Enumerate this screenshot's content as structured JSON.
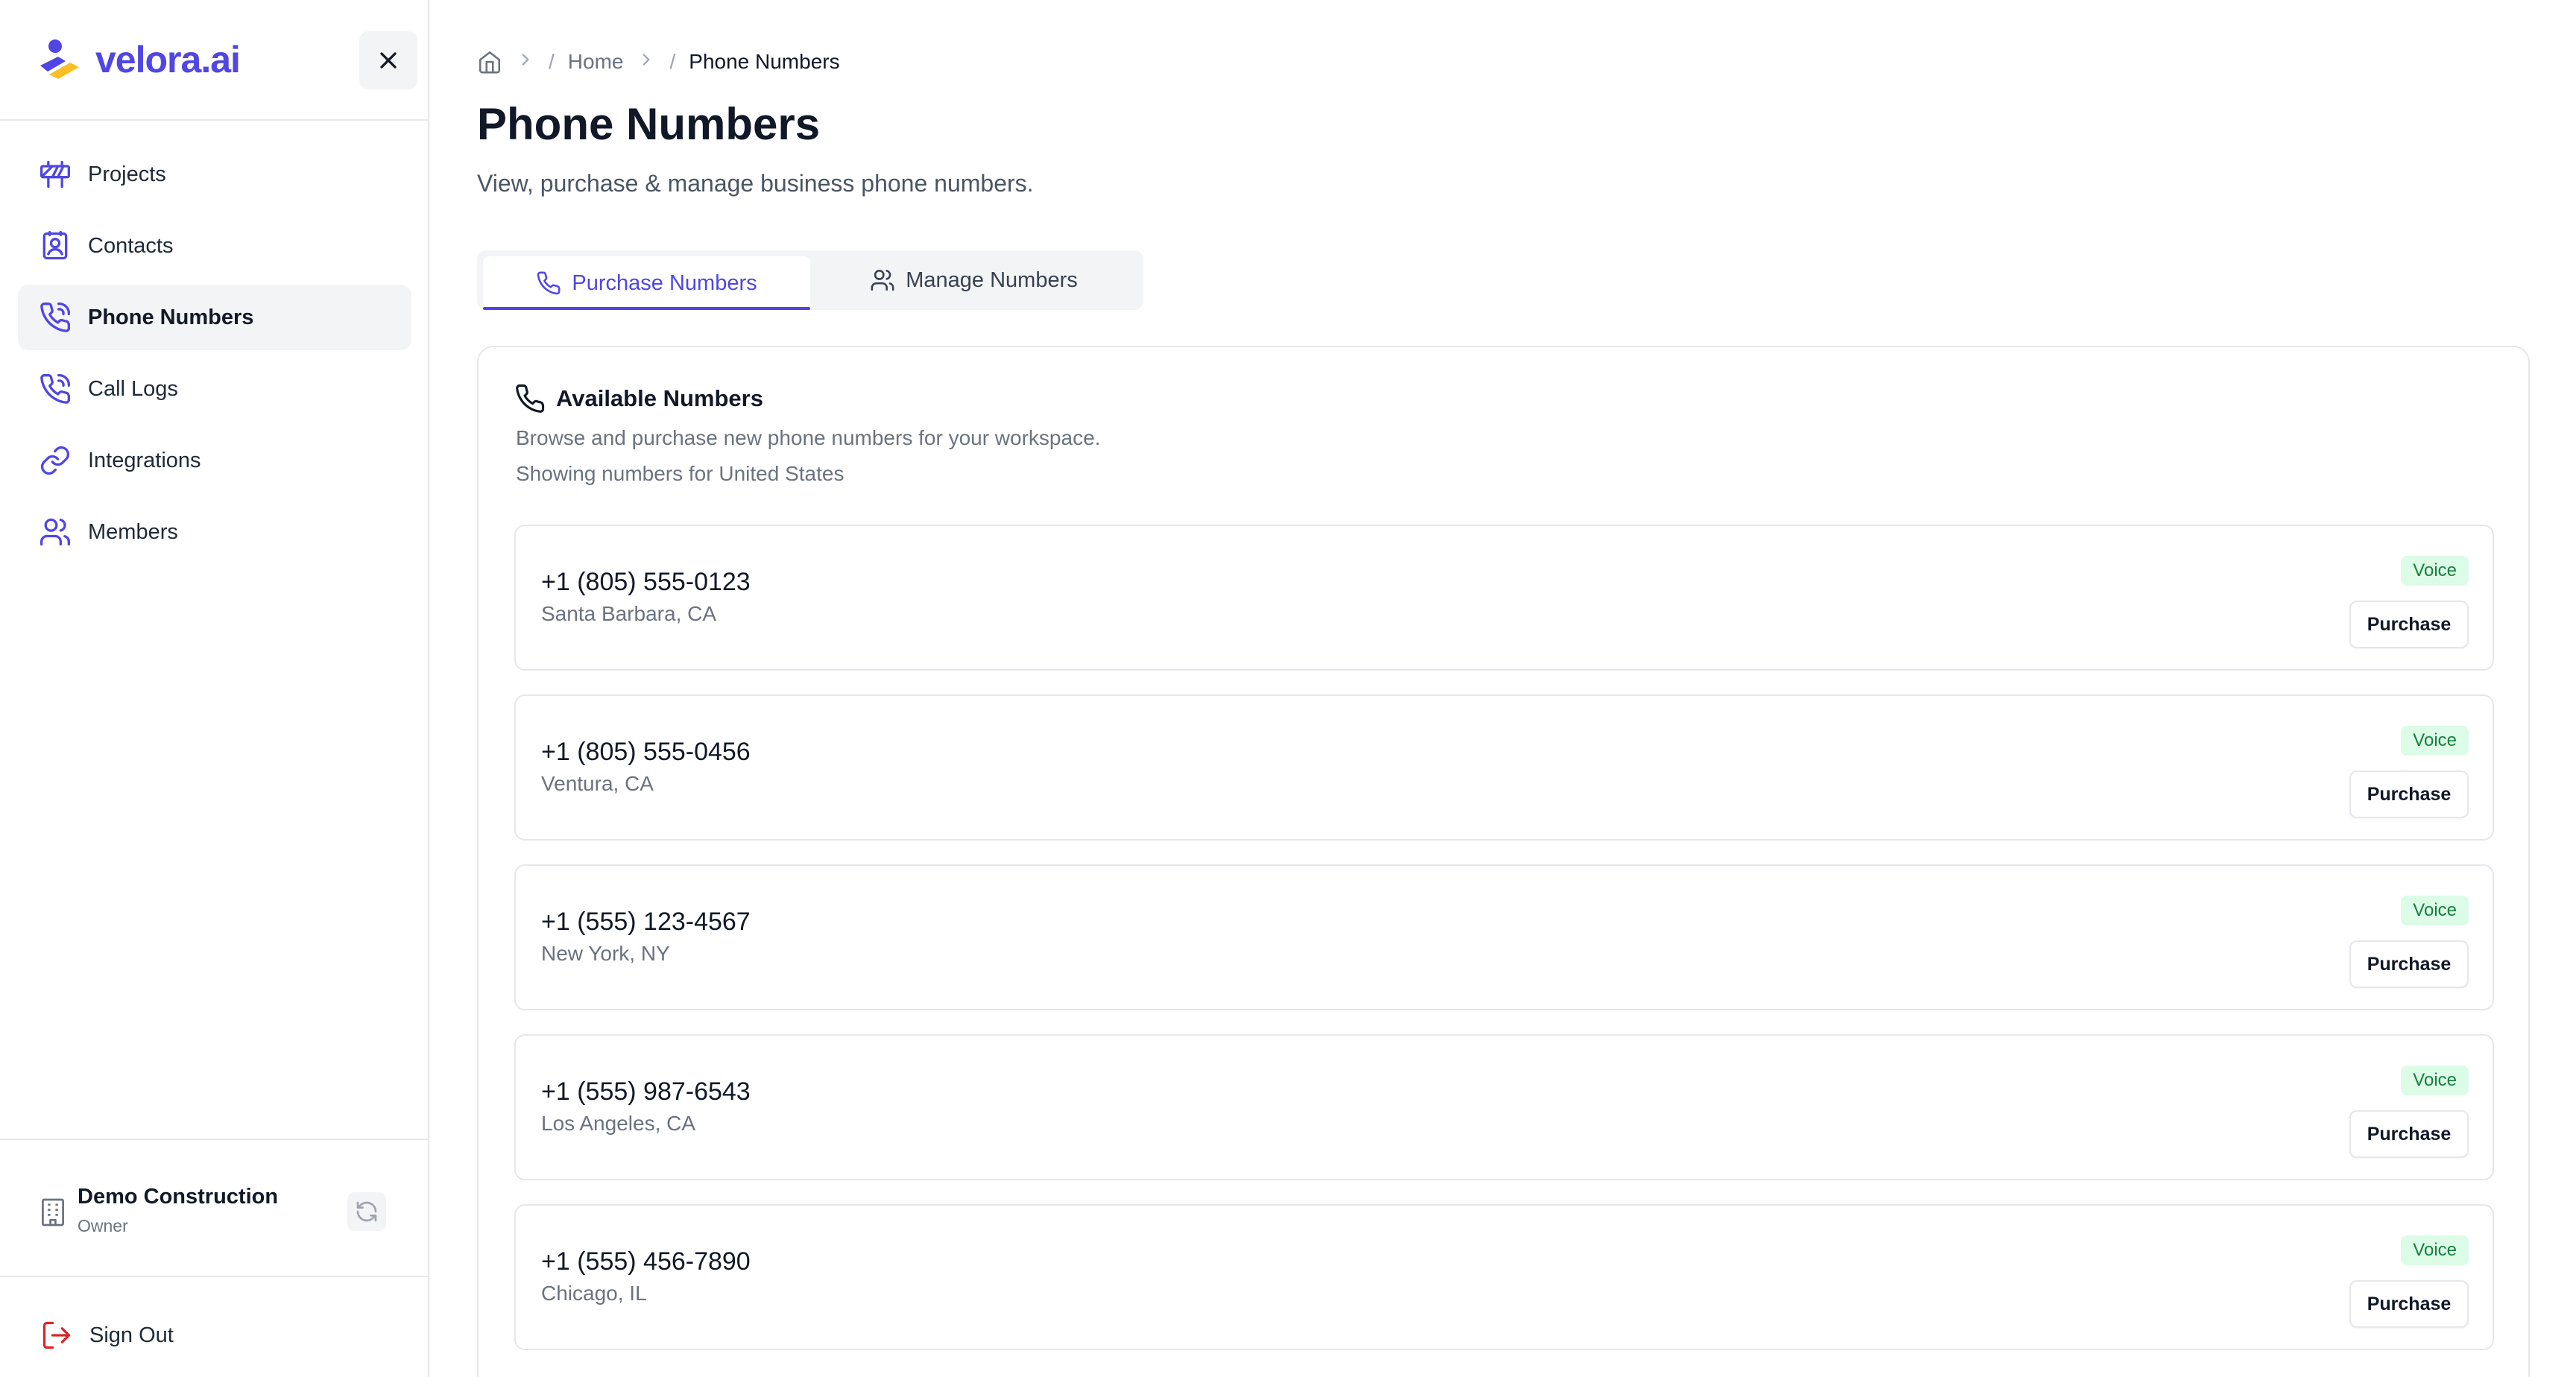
{
  "app": {
    "logo_text": "velora.ai",
    "accent": "#4f46e5"
  },
  "sidebar": {
    "items": [
      {
        "label": "Projects",
        "icon": "construction-barrier-icon"
      },
      {
        "label": "Contacts",
        "icon": "contact-book-icon"
      },
      {
        "label": "Phone Numbers",
        "icon": "phone-call-icon",
        "active": true
      },
      {
        "label": "Call Logs",
        "icon": "phone-call-icon"
      },
      {
        "label": "Integrations",
        "icon": "link-icon"
      },
      {
        "label": "Members",
        "icon": "users-icon"
      }
    ],
    "workspace": {
      "name": "Demo Construction",
      "role": "Owner"
    },
    "sign_out_label": "Sign Out"
  },
  "breadcrumb": {
    "home_label": "Home",
    "current_label": "Phone Numbers"
  },
  "page": {
    "title": "Phone Numbers",
    "subtitle": "View, purchase & manage business phone numbers."
  },
  "tabs": [
    {
      "label": "Purchase Numbers",
      "active": true
    },
    {
      "label": "Manage Numbers",
      "active": false
    }
  ],
  "available": {
    "title": "Available Numbers",
    "description": "Browse and purchase new phone numbers for your workspace.",
    "country_note": "Showing numbers for United States",
    "numbers": [
      {
        "phone": "+1 (805) 555-0123",
        "location": "Santa Barbara, CA",
        "badge": "Voice",
        "action": "Purchase"
      },
      {
        "phone": "+1 (805) 555-0456",
        "location": "Ventura, CA",
        "badge": "Voice",
        "action": "Purchase"
      },
      {
        "phone": "+1 (555) 123-4567",
        "location": "New York, NY",
        "badge": "Voice",
        "action": "Purchase"
      },
      {
        "phone": "+1 (555) 987-6543",
        "location": "Los Angeles, CA",
        "badge": "Voice",
        "action": "Purchase"
      },
      {
        "phone": "+1 (555) 456-7890",
        "location": "Chicago, IL",
        "badge": "Voice",
        "action": "Purchase"
      }
    ]
  }
}
